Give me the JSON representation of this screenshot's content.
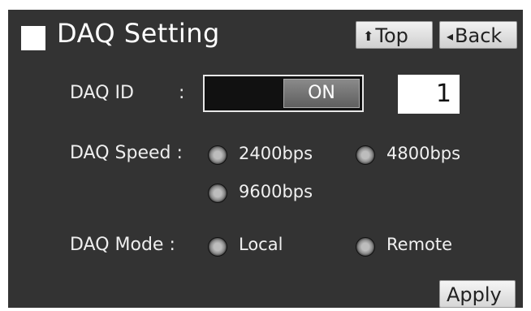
{
  "header": {
    "title": "DAQ Setting",
    "top_label": "Top",
    "back_label": "Back"
  },
  "icons": {
    "title_square": "white-square",
    "top": "up-arrow",
    "back": "left-triangle"
  },
  "daq_id": {
    "label": "DAQ ID",
    "colon": ":",
    "toggle_value": "ON",
    "id_value": "1"
  },
  "daq_speed": {
    "label": "DAQ Speed :",
    "options": [
      "2400bps",
      "4800bps",
      "9600bps"
    ]
  },
  "daq_mode": {
    "label": "DAQ Mode :",
    "options": [
      "Local",
      "Remote"
    ]
  },
  "footer": {
    "apply_label": "Apply"
  }
}
